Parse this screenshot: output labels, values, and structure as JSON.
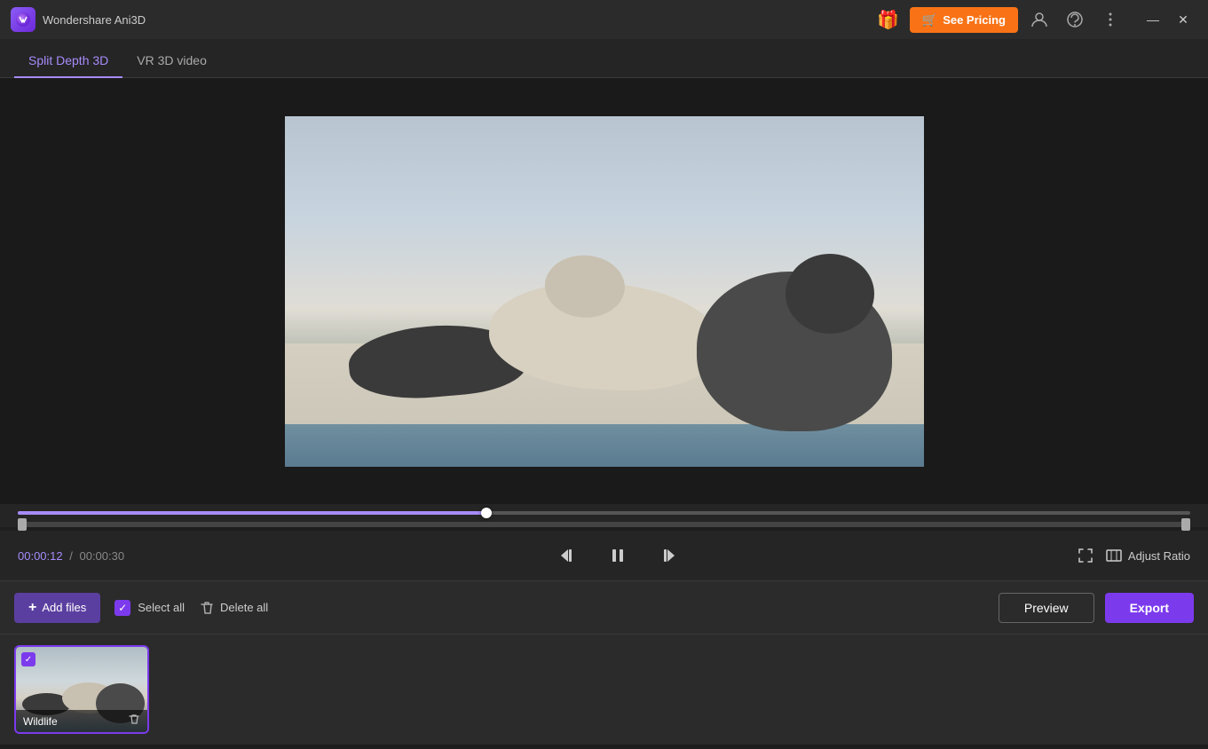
{
  "app": {
    "title": "Wondershare Ani3D",
    "logo_letter": "W"
  },
  "titlebar": {
    "gift_icon": "🎁",
    "see_pricing_label": "See Pricing",
    "cart_icon": "🛒",
    "user_icon": "👤",
    "headset_icon": "🎧",
    "menu_icon": "☰",
    "minimize_icon": "—",
    "close_icon": "✕"
  },
  "tabs": [
    {
      "label": "Split Depth 3D",
      "active": true
    },
    {
      "label": "VR 3D video",
      "active": false
    }
  ],
  "player": {
    "current_time": "00:00:12",
    "total_time": "00:00:30",
    "separator": "/",
    "adjust_ratio_label": "Adjust Ratio",
    "skip_back_icon": "⏮",
    "pause_icon": "⏸",
    "skip_forward_icon": "⏭",
    "fullscreen_icon": "⛶",
    "aspect_icon": "⊡"
  },
  "toolbar": {
    "add_files_label": "Add files",
    "add_icon": "+",
    "select_all_label": "Select all",
    "delete_all_label": "Delete all",
    "preview_label": "Preview",
    "export_label": "Export"
  },
  "files": [
    {
      "name": "Wildlife",
      "checked": true
    }
  ],
  "colors": {
    "accent_purple": "#7c3aed",
    "accent_light_purple": "#a78bfa",
    "orange": "#f97316",
    "bg_dark": "#1e1e1e",
    "bg_panel": "#252525",
    "bg_toolbar": "#2b2b2b"
  }
}
